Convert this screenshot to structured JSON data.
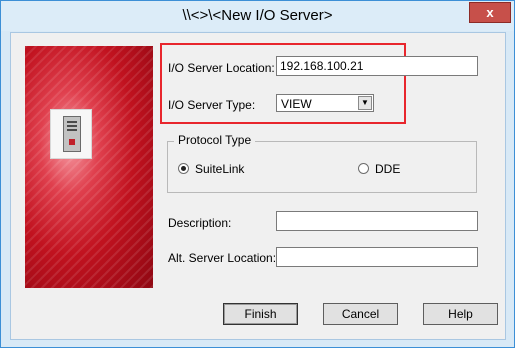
{
  "window": {
    "title": "\\\\<>\\<New I/O Server>",
    "close_label": "x"
  },
  "form": {
    "location_label": "I/O Server Location:",
    "location_value": "192.168.100.21",
    "type_label": "I/O Server Type:",
    "type_value": "VIEW",
    "protocol_group_label": "Protocol Type",
    "protocol_options": [
      {
        "label": "SuiteLink",
        "selected": true
      },
      {
        "label": "DDE",
        "selected": false
      }
    ],
    "description_label": "Description:",
    "description_value": "",
    "alt_location_label": "Alt. Server Location:",
    "alt_location_value": ""
  },
  "buttons": {
    "finish": "Finish",
    "cancel": "Cancel",
    "help": "Help"
  },
  "colors": {
    "highlight": "#e8262d",
    "banner": "#c1121f",
    "window_border": "#3c8fd6"
  },
  "icons": {
    "banner_icon": "server-computer-icon",
    "select_arrow": "chevron-down-icon"
  }
}
